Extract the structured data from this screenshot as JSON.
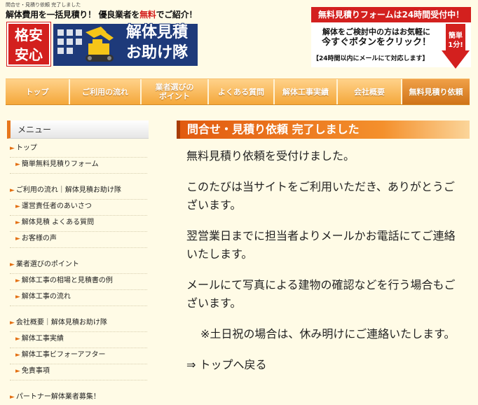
{
  "header": {
    "breadcrumb": "問合せ・見積り依頼 完了しました",
    "tagline_part1": "解体費用を一括見積り！",
    "tagline_part2": "優良業者を",
    "tagline_red": "無料",
    "tagline_part3": "でご紹介！",
    "badge_line1": "格安",
    "badge_line2": "安心",
    "logo_line1": "解体見積",
    "logo_line2": "お助け隊"
  },
  "cta": {
    "banner": "無料見積りフォームは24時間受付中！",
    "line1": "解体をご検討中の方はお気軽に",
    "line2": "今すぐボタンをクリック！",
    "arrow_line1": "簡単",
    "arrow_line2": "1分!",
    "note": "【24時間以内にメールにて対応します】"
  },
  "nav": {
    "items": [
      {
        "label": "トップ"
      },
      {
        "label": "ご利用の流れ"
      },
      {
        "label": "業者選びの\nポイント"
      },
      {
        "label": "よくある質問"
      },
      {
        "label": "解体工事実績"
      },
      {
        "label": "会社概要"
      },
      {
        "label": "無料見積り依頼"
      }
    ]
  },
  "sidebar": {
    "title": "メニュー",
    "items": [
      {
        "label": "トップ",
        "level": "top"
      },
      {
        "label": "簡単無料見積りフォーム",
        "level": "sub"
      },
      {
        "label": "ご利用の流れ｜解体見積お助け隊",
        "level": "top"
      },
      {
        "label": "運営責任者のあいさつ",
        "level": "sub"
      },
      {
        "label": "解体見積 よくある質問",
        "level": "sub"
      },
      {
        "label": "お客様の声",
        "level": "sub"
      },
      {
        "label": "業者選びのポイント",
        "level": "top"
      },
      {
        "label": "解体工事の相場と見積書の例",
        "level": "sub"
      },
      {
        "label": "解体工事の流れ",
        "level": "sub"
      },
      {
        "label": "会社概要｜解体見積お助け隊",
        "level": "top"
      },
      {
        "label": "解体工事実績",
        "level": "sub"
      },
      {
        "label": "解体工事ビフォーアフター",
        "level": "sub"
      },
      {
        "label": "免責事項",
        "level": "sub"
      },
      {
        "label": "パートナー解体業者募集！",
        "level": "top"
      }
    ]
  },
  "main": {
    "title": "問合せ・見積り依頼 完了しました",
    "paragraphs": [
      "無料見積り依頼を受付けました。",
      "このたびは当サイトをご利用いただき、ありがとうございます。",
      "翌営業日までに担当者よりメールかお電話にてご連絡いたします。",
      "メールにて写真による建物の確認などを行う場合もございます。",
      "※土日祝の場合は、休み明けにご連絡いたします。"
    ],
    "back_link": "⇒ トップへ戻る"
  },
  "colors": {
    "accent_orange": "#e7771c",
    "brand_red": "#d3201e",
    "logo_blue": "#1e3a7a",
    "background": "#fffbe6"
  }
}
